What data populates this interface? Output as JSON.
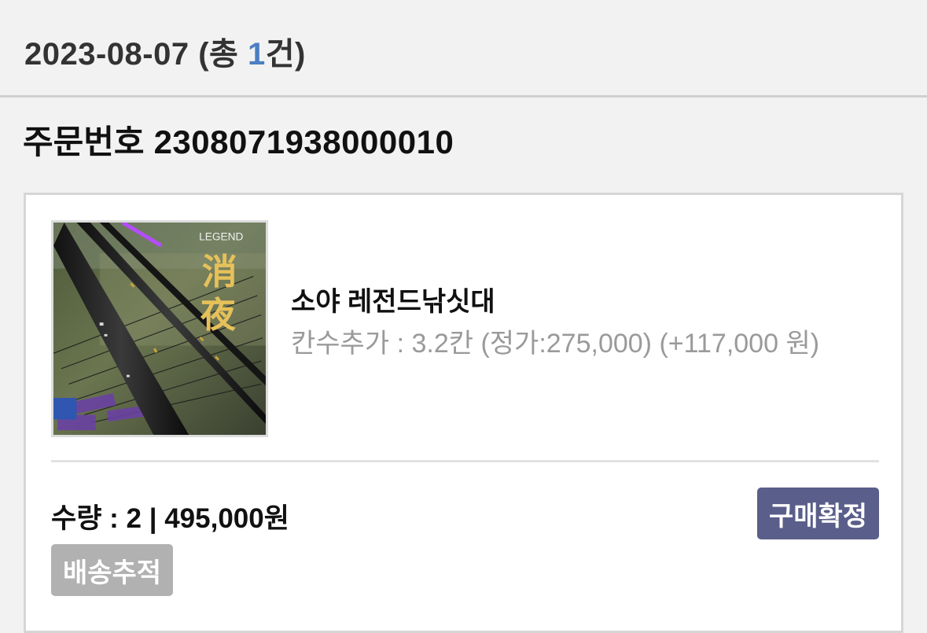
{
  "header": {
    "date": "2023-08-07",
    "count_prefix": "(총 ",
    "count_value": "1",
    "count_suffix": "건)"
  },
  "order": {
    "label": "주문번호",
    "number": "2308071938000010"
  },
  "item": {
    "image": {
      "brand_text": "LEGEND",
      "calligraphy_1": "消",
      "calligraphy_2": "夜"
    },
    "name": "소야 레전드낚싯대",
    "option": "칸수추가 : 3.2칸 (정가:275,000) (+117,000 원)",
    "quantity_line": "수량 : 2 | 495,000원"
  },
  "actions": {
    "confirm_label": "구매확정",
    "tracking_label": "배송추적"
  },
  "colors": {
    "background": "#f2f2f2",
    "count_accent": "#4a7fc1",
    "confirm_button": "#5a5e8a",
    "tracking_button": "#b1b1b1",
    "option_text": "#9a9a9a"
  }
}
